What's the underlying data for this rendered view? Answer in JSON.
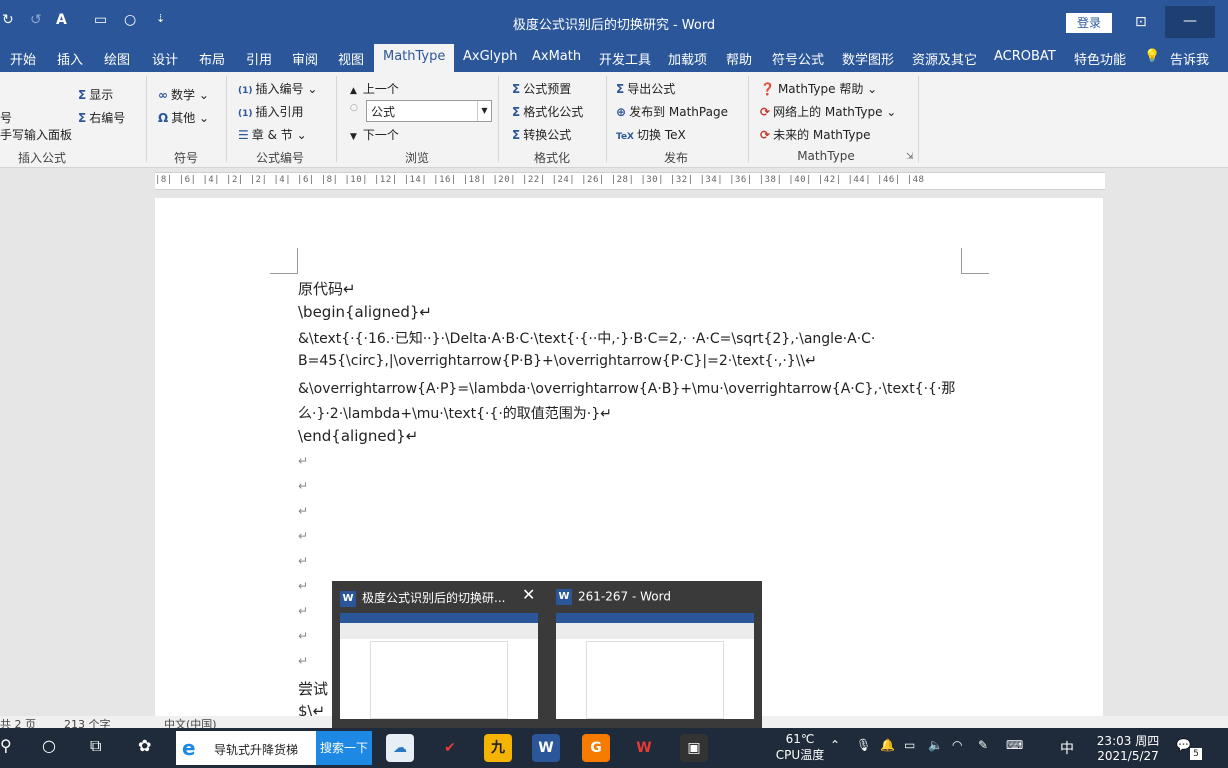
{
  "window": {
    "title": "极度公式识别后的切换研究  -  Word",
    "login_label": "登录",
    "minimize_glyph": "—"
  },
  "quick_access": {
    "redo_glyph": "↺",
    "format_glyph": "A",
    "circle_glyph": "○",
    "customize_glyph": "⇣"
  },
  "tabs": [
    "开始",
    "插入",
    "绘图",
    "设计",
    "布局",
    "引用",
    "审阅",
    "视图",
    "MathType",
    "AxGlyph",
    "AxMath",
    "开发工具",
    "加载项",
    "帮助",
    "符号公式",
    "数学图形",
    "资源及其它",
    "ACROBAT",
    "特色功能",
    "告诉我"
  ],
  "active_tab": "MathType",
  "ribbon": {
    "insert_group": {
      "label": "插入公式",
      "items": [
        "号",
        "手写输入面板"
      ],
      "display_label": "显示",
      "right_number_label": "右编号"
    },
    "symbols_group": {
      "label": "符号",
      "math_label": "数学",
      "other_label": "其他"
    },
    "numbering_group": {
      "label": "公式编号",
      "insert_number_label": "插入编号",
      "insert_ref_label": "插入引用",
      "chapter_section_label": "章 & 节"
    },
    "browse_group": {
      "label": "浏览",
      "prev_label": "上一个",
      "combo_value": "公式",
      "next_label": "下一个"
    },
    "format_group": {
      "label": "格式化",
      "preset_label": "公式预置",
      "format_label": "格式化公式",
      "convert_label": "转换公式"
    },
    "publish_group": {
      "label": "发布",
      "export_label": "导出公式",
      "publish_label": "发布到 MathPage",
      "tex_label": "切换 TeX"
    },
    "mathtype_group": {
      "label": "MathType",
      "help_label": "MathType 帮助",
      "online_label": "网络上的 MathType",
      "future_label": "未来的 MathType"
    }
  },
  "ruler_text": "|8| |6| |4| |2|  |2| |4| |6| |8| |10| |12| |14| |16| |18| |20| |22| |24| |26| |28| |30| |32| |34| |36| |38| |40| |42| |44| |46| |48",
  "document": {
    "lines": [
      "原代码↵",
      "\\begin{aligned}↵",
      "&\\text{·{·16.·已知··}·\\Delta·A·B·C·\\text{·{··中,·}·B·C=2,·  ·A·C=\\sqrt{2},·\\angle·A·C·",
      "B=45{\\circ},|\\overrightarrow{P·B}+\\overrightarrow{P·C}|=2·\\text{·,·}\\\\↵",
      "&\\overrightarrow{A·P}=\\lambda·\\overrightarrow{A·B}+\\mu·\\overrightarrow{A·C},·\\text{·{·那",
      "么·}·2·\\lambda+\\mu·\\text{·{·的取值范围为·}↵",
      "\\end{aligned}↵"
    ],
    "empty_paragraphs": [
      "↵",
      "↵",
      "↵",
      "↵",
      "↵",
      "↵",
      "↵",
      "↵",
      "↵"
    ],
    "bottom_lines": [
      "尝试",
      "$\\↵"
    ]
  },
  "statusbar": {
    "page": "共 2 页",
    "words": "213 个字",
    "lang": "中文(中国)"
  },
  "popup": {
    "thumb1_title": "极度公式识别后的切换研...",
    "thumb2_title": "261-267 - Word",
    "close_glyph": "✕"
  },
  "taskbar": {
    "search_text": "导轨式升降货梯",
    "search_button": "搜索一下",
    "temp": "61℃",
    "cpu_label": "CPU温度",
    "ime": "中",
    "time": "23:03 周四",
    "date": "2021/5/27",
    "notif_count": "5"
  }
}
